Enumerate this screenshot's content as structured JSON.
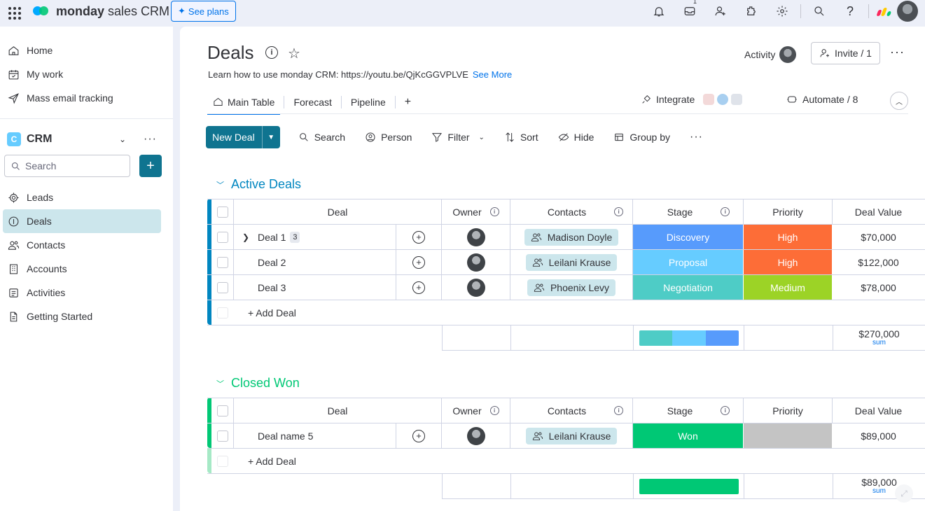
{
  "topbar": {
    "brand_bold": "monday",
    "brand_rest": " sales CRM",
    "see_plans": "See plans",
    "inbox_badge": "1"
  },
  "sidebar": {
    "nav": [
      {
        "label": "Home",
        "icon": "home-icon"
      },
      {
        "label": "My work",
        "icon": "calendar-check-icon"
      },
      {
        "label": "Mass email tracking",
        "icon": "send-icon"
      }
    ],
    "workspace": {
      "badge": "C",
      "name": "CRM"
    },
    "search_placeholder": "Search",
    "boards": [
      {
        "label": "Leads",
        "icon": "target-icon"
      },
      {
        "label": "Deals",
        "icon": "dollar-icon",
        "active": true
      },
      {
        "label": "Contacts",
        "icon": "people-icon"
      },
      {
        "label": "Accounts",
        "icon": "building-icon"
      },
      {
        "label": "Activities",
        "icon": "list-icon"
      },
      {
        "label": "Getting Started",
        "icon": "doc-icon"
      }
    ]
  },
  "board": {
    "title": "Deals",
    "description": "Learn how to use monday CRM: https://youtu.be/QjKcGGVPLVE",
    "see_more": "See More",
    "activity": "Activity",
    "invite": "Invite / 1",
    "tabs": [
      "Main Table",
      "Forecast",
      "Pipeline",
      "+"
    ],
    "integrate": "Integrate",
    "automate": "Automate / 8"
  },
  "toolbar": {
    "new_deal": "New Deal",
    "search": "Search",
    "person": "Person",
    "filter": "Filter",
    "sort": "Sort",
    "hide": "Hide",
    "group_by": "Group by"
  },
  "columns": {
    "deal": "Deal",
    "owner": "Owner",
    "contacts": "Contacts",
    "stage": "Stage",
    "priority": "Priority",
    "deal_value": "Deal Value"
  },
  "colors": {
    "active_group": "#0086c0",
    "won_group": "#00c875",
    "discovery": "#579bfc",
    "proposal": "#66ccff",
    "negotiation": "#4eccc6",
    "won": "#00c875",
    "high": "#fd6d37",
    "medium": "#9cd326",
    "empty": "#c4c4c4"
  },
  "groups": [
    {
      "name": "Active Deals",
      "rows": [
        {
          "deal": "Deal 1",
          "subitems": "3",
          "contact": "Madison Doyle",
          "stage": "Discovery",
          "priority": "High",
          "value": "$70,000"
        },
        {
          "deal": "Deal 2",
          "contact": "Leilani Krause",
          "stage": "Proposal",
          "priority": "High",
          "value": "$122,000"
        },
        {
          "deal": "Deal 3",
          "contact": "Phoenix Levy",
          "stage": "Negotiation",
          "priority": "Medium",
          "value": "$78,000"
        }
      ],
      "add_label": "+ Add Deal",
      "sum": "$270,000",
      "sum_label": "sum"
    },
    {
      "name": "Closed Won",
      "rows": [
        {
          "deal": "Deal name 5",
          "contact": "Leilani Krause",
          "stage": "Won",
          "priority": "",
          "value": "$89,000"
        }
      ],
      "add_label": "+ Add Deal",
      "sum": "$89,000",
      "sum_label": "sum"
    }
  ]
}
